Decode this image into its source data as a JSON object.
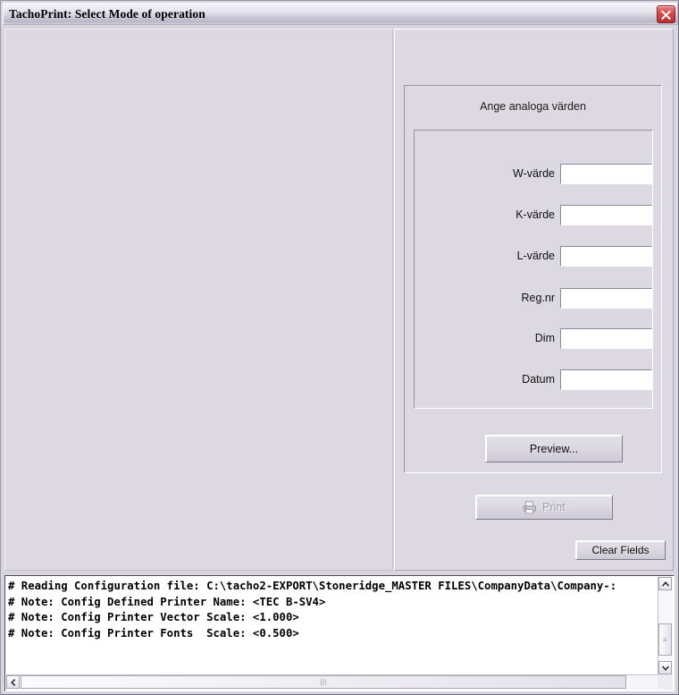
{
  "window": {
    "title": "TachoPrint: Select Mode of operation",
    "close_icon": "close-icon",
    "close_label": "Close"
  },
  "mode_panel": {
    "group_title": "Ange analoga värden",
    "fields": [
      {
        "label": "W-värde",
        "value": "",
        "placeholder": ""
      },
      {
        "label": "K-värde",
        "value": "",
        "placeholder": ""
      },
      {
        "label": "L-värde",
        "value": "",
        "placeholder": ""
      },
      {
        "label": "Reg.nr",
        "value": "",
        "placeholder": ""
      },
      {
        "label": "Dim",
        "value": "",
        "placeholder": ""
      },
      {
        "label": "Datum",
        "value": "",
        "placeholder": ""
      }
    ],
    "preview_button": "Preview...",
    "print_button": "Print",
    "print_icon": "printer-icon",
    "print_enabled": false,
    "clear_button": "Clear Fields"
  },
  "console": {
    "lines": [
      "# Reading Configuration file: C:\\tacho2-EXPORT\\Stoneridge_MASTER FILES\\CompanyData\\Company-:",
      "# Note: Config Defined Printer Name: <TEC B-SV4>",
      "# Note: Config Printer Vector Scale: <1.000>",
      "# Note: Config Printer Fonts  Scale: <0.500>"
    ],
    "scroll_up_icon": "chevron-up-icon",
    "scroll_down_icon": "chevron-down-icon",
    "scroll_left_icon": "chevron-left-icon",
    "scroll_right_icon": "chevron-right-icon"
  },
  "colors": {
    "window_face": "#d8d5de",
    "title_text": "#000000",
    "close_red": "#d14b4b",
    "console_bg": "#ffffff",
    "disabled_text": "#9b98a6"
  }
}
